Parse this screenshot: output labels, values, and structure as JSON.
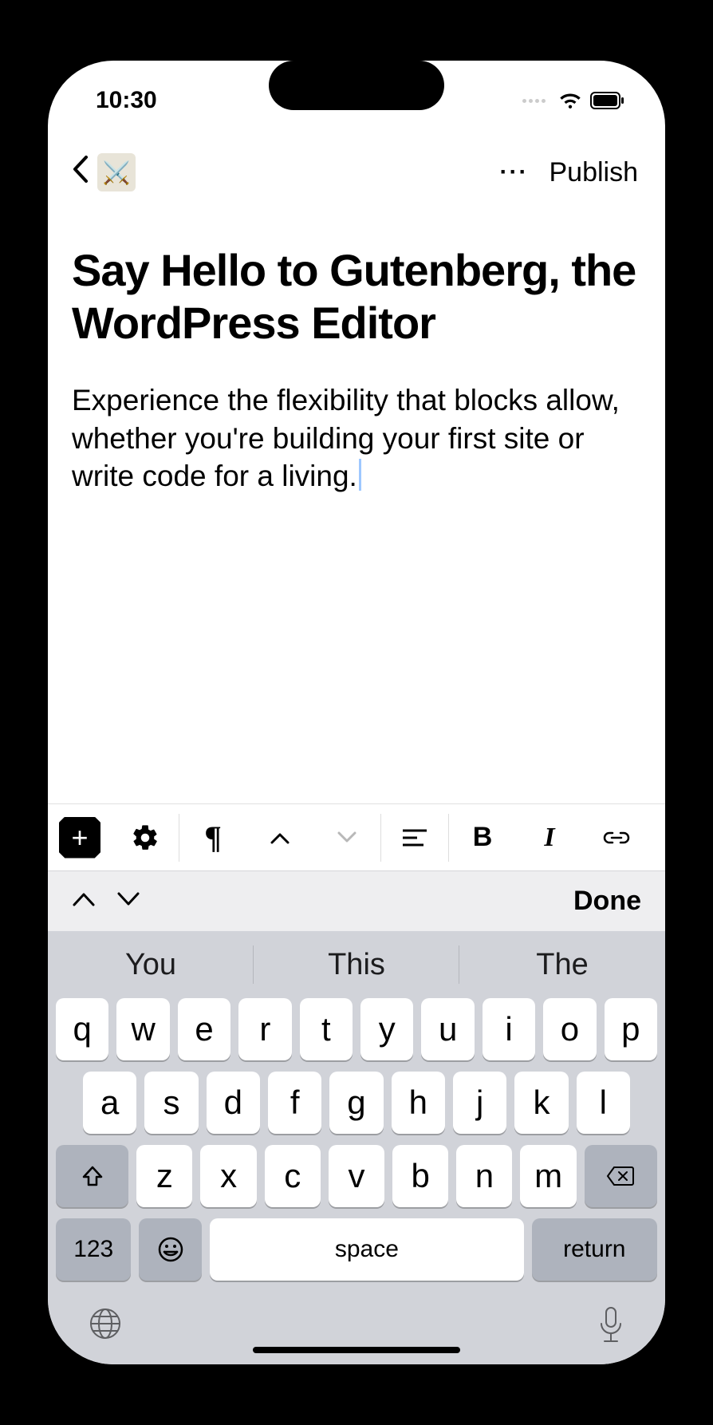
{
  "status": {
    "time": "10:30"
  },
  "nav": {
    "site_icon_glyph": "⚔️",
    "more_glyph": "···",
    "publish_label": "Publish"
  },
  "editor": {
    "title": "Say Hello to Gutenberg, the WordPress Editor",
    "body": "Experience the flexibility that blocks allow, whether you're building your first site or write code for a living."
  },
  "toolbar": {
    "plus": "+",
    "gear": "⚙",
    "paragraph": "¶",
    "up": "⌃",
    "down": "⌄",
    "align": "align-left",
    "bold": "B",
    "italic": "I",
    "link": "link"
  },
  "accessory": {
    "done_label": "Done"
  },
  "keyboard": {
    "suggestions": [
      "You",
      "This",
      "The"
    ],
    "row1": [
      "q",
      "w",
      "e",
      "r",
      "t",
      "y",
      "u",
      "i",
      "o",
      "p"
    ],
    "row2": [
      "a",
      "s",
      "d",
      "f",
      "g",
      "h",
      "j",
      "k",
      "l"
    ],
    "row3": [
      "z",
      "x",
      "c",
      "v",
      "b",
      "n",
      "m"
    ],
    "numeric_label": "123",
    "space_label": "space",
    "return_label": "return"
  }
}
